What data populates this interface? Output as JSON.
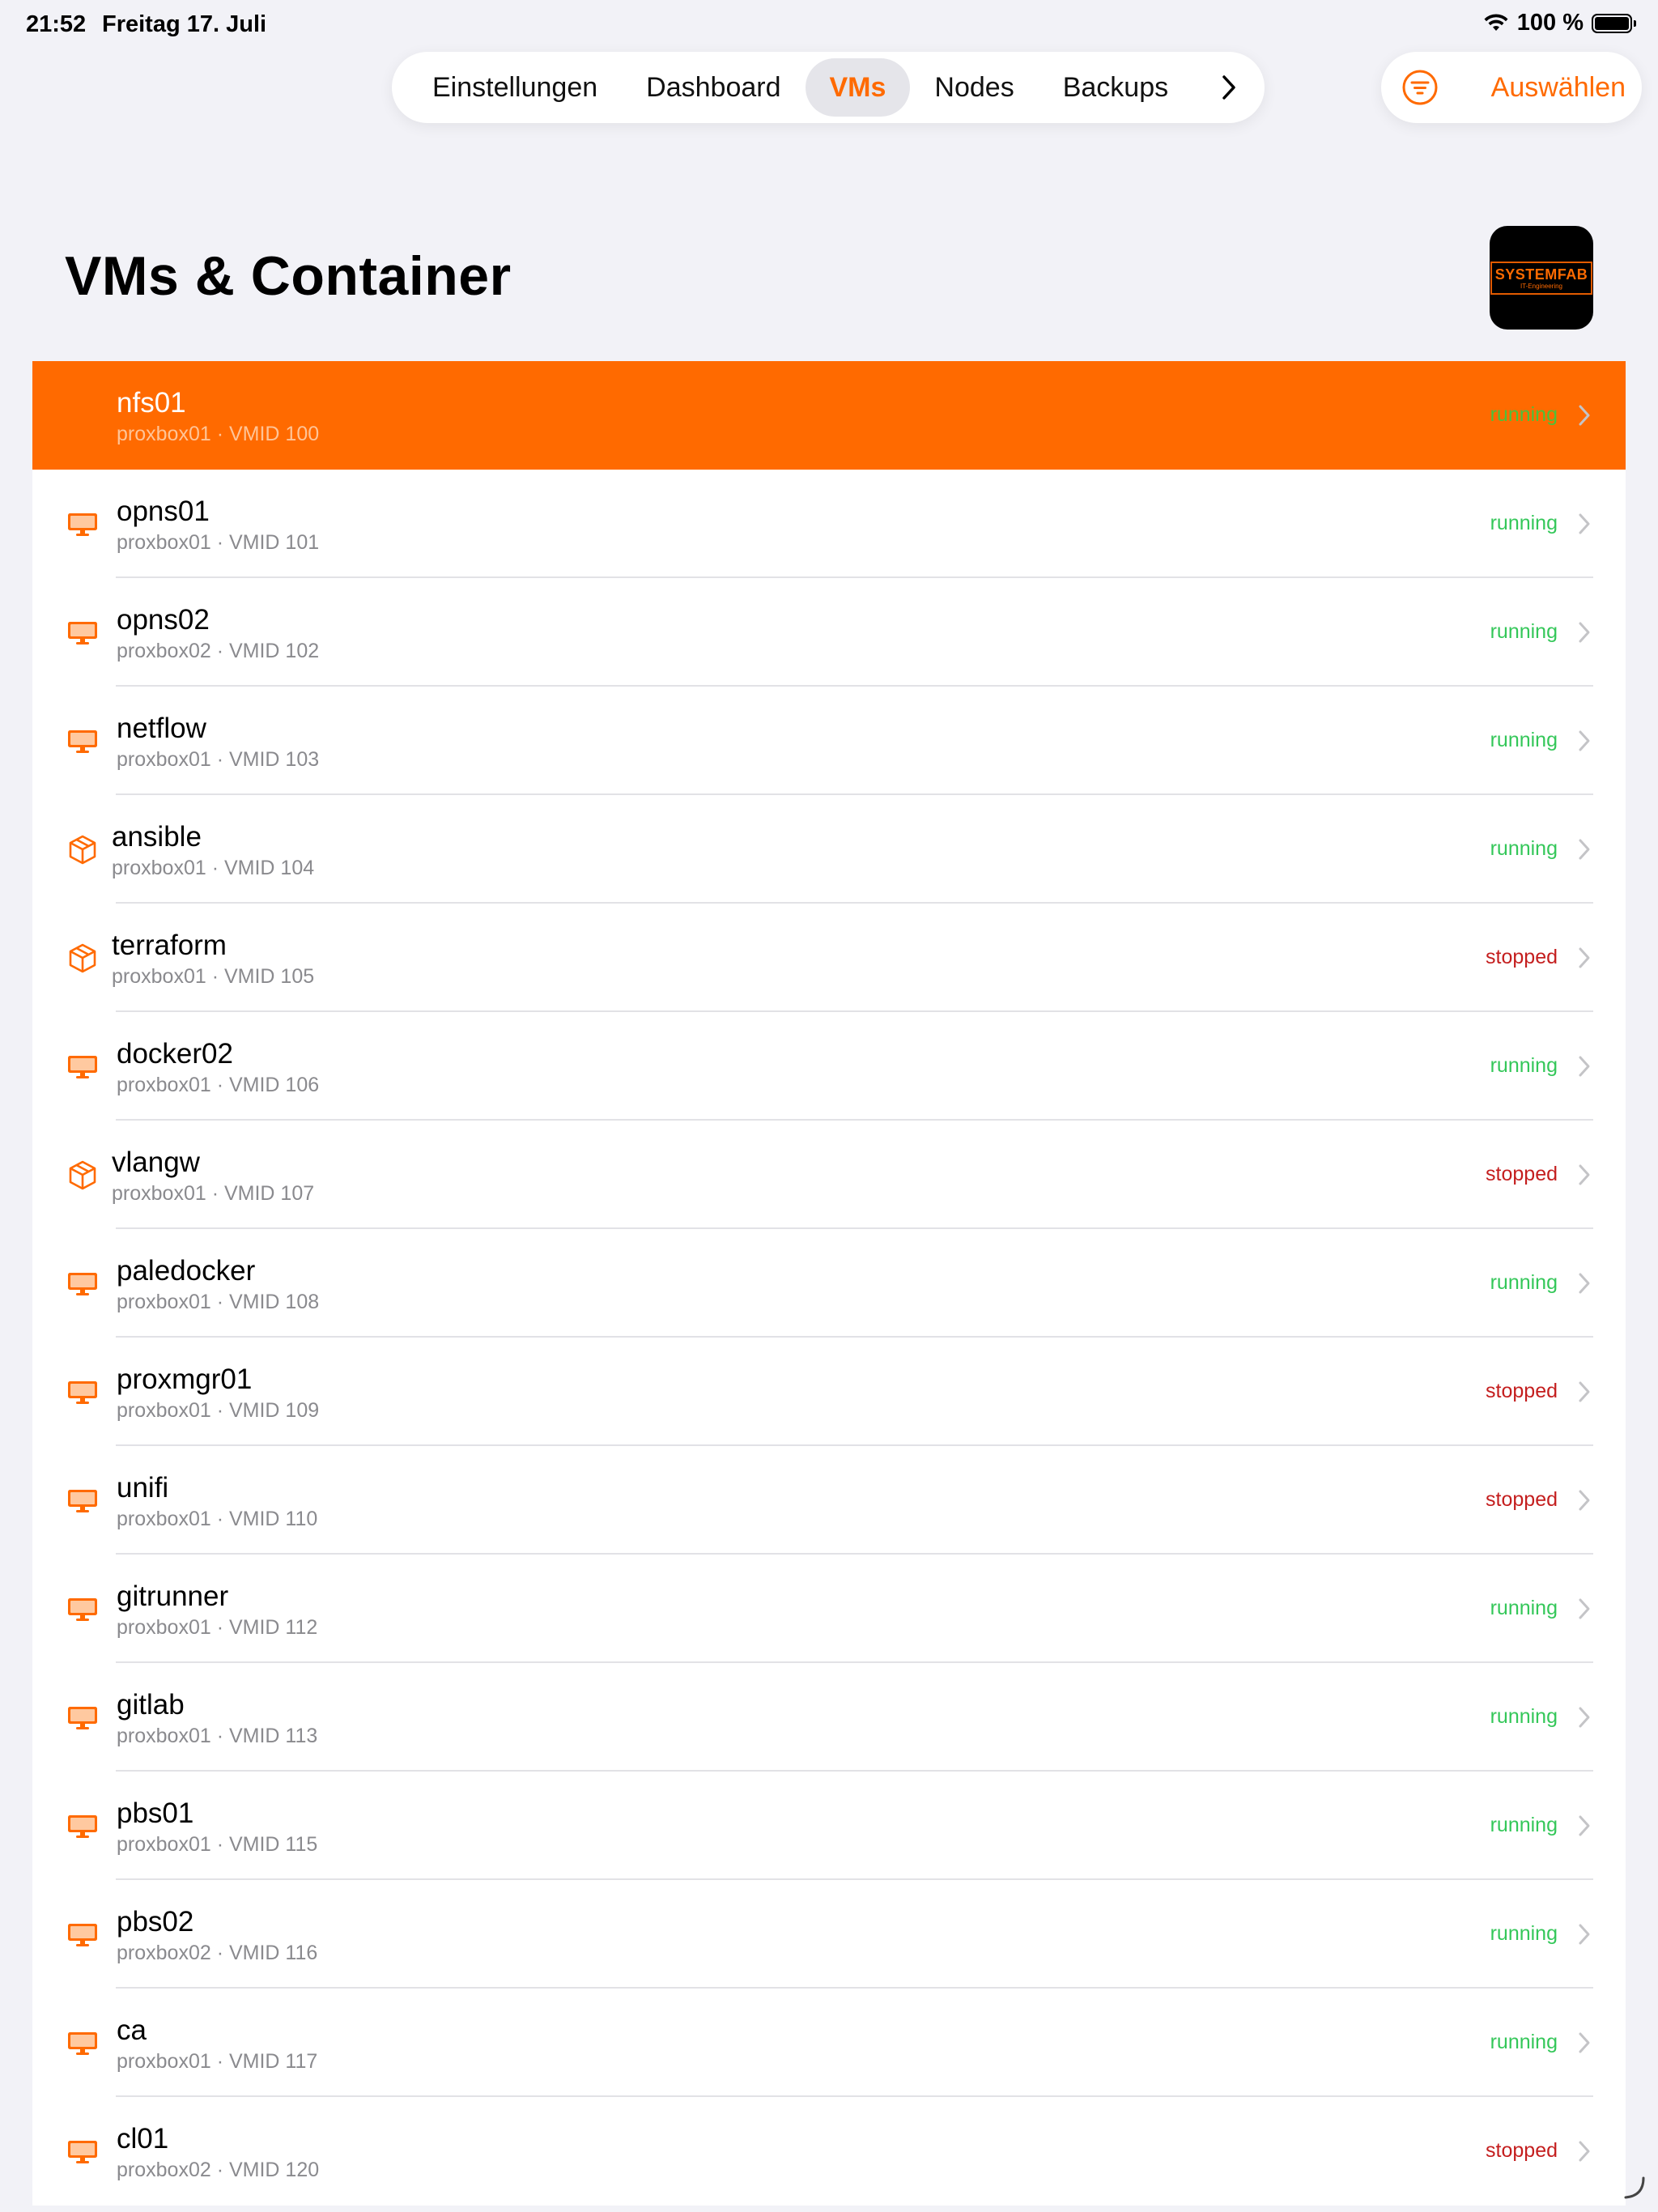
{
  "status_bar": {
    "time": "21:52",
    "date": "Freitag 17. Juli",
    "battery": "100 %",
    "battery_level": 1.0
  },
  "tabs": [
    {
      "label": "Einstellungen",
      "active": false
    },
    {
      "label": "Dashboard",
      "active": false
    },
    {
      "label": "VMs",
      "active": true
    },
    {
      "label": "Nodes",
      "active": false
    },
    {
      "label": "Backups",
      "active": false
    }
  ],
  "actions": {
    "select_label": "Auswählen",
    "filter_icon": "filter-circle-icon"
  },
  "page": {
    "title": "VMs & Container",
    "logo": {
      "main": "SYSTEMFAB",
      "sub": "IT-Engineering"
    }
  },
  "colors": {
    "accent": "#ff6a00",
    "running": "#34c759",
    "stopped": "#c41e1e",
    "background": "#f2f2f7"
  },
  "vms": [
    {
      "name": "nfs01",
      "node": "proxbox01",
      "vmid": "VMID 100",
      "status": "running",
      "type": "vm",
      "selected": true
    },
    {
      "name": "opns01",
      "node": "proxbox01",
      "vmid": "VMID 101",
      "status": "running",
      "type": "vm"
    },
    {
      "name": "opns02",
      "node": "proxbox02",
      "vmid": "VMID 102",
      "status": "running",
      "type": "vm"
    },
    {
      "name": "netflow",
      "node": "proxbox01",
      "vmid": "VMID 103",
      "status": "running",
      "type": "vm"
    },
    {
      "name": "ansible",
      "node": "proxbox01",
      "vmid": "VMID 104",
      "status": "running",
      "type": "ct"
    },
    {
      "name": "terraform",
      "node": "proxbox01",
      "vmid": "VMID 105",
      "status": "stopped",
      "type": "ct"
    },
    {
      "name": "docker02",
      "node": "proxbox01",
      "vmid": "VMID 106",
      "status": "running",
      "type": "vm"
    },
    {
      "name": "vlangw",
      "node": "proxbox01",
      "vmid": "VMID 107",
      "status": "stopped",
      "type": "ct"
    },
    {
      "name": "paledocker",
      "node": "proxbox01",
      "vmid": "VMID 108",
      "status": "running",
      "type": "vm"
    },
    {
      "name": "proxmgr01",
      "node": "proxbox01",
      "vmid": "VMID 109",
      "status": "stopped",
      "type": "vm"
    },
    {
      "name": "unifi",
      "node": "proxbox01",
      "vmid": "VMID 110",
      "status": "stopped",
      "type": "vm"
    },
    {
      "name": "gitrunner",
      "node": "proxbox01",
      "vmid": "VMID 112",
      "status": "running",
      "type": "vm"
    },
    {
      "name": "gitlab",
      "node": "proxbox01",
      "vmid": "VMID 113",
      "status": "running",
      "type": "vm"
    },
    {
      "name": "pbs01",
      "node": "proxbox01",
      "vmid": "VMID 115",
      "status": "running",
      "type": "vm"
    },
    {
      "name": "pbs02",
      "node": "proxbox02",
      "vmid": "VMID 116",
      "status": "running",
      "type": "vm"
    },
    {
      "name": "ca",
      "node": "proxbox01",
      "vmid": "VMID 117",
      "status": "running",
      "type": "vm"
    },
    {
      "name": "cl01",
      "node": "proxbox02",
      "vmid": "VMID 120",
      "status": "stopped",
      "type": "vm"
    }
  ]
}
